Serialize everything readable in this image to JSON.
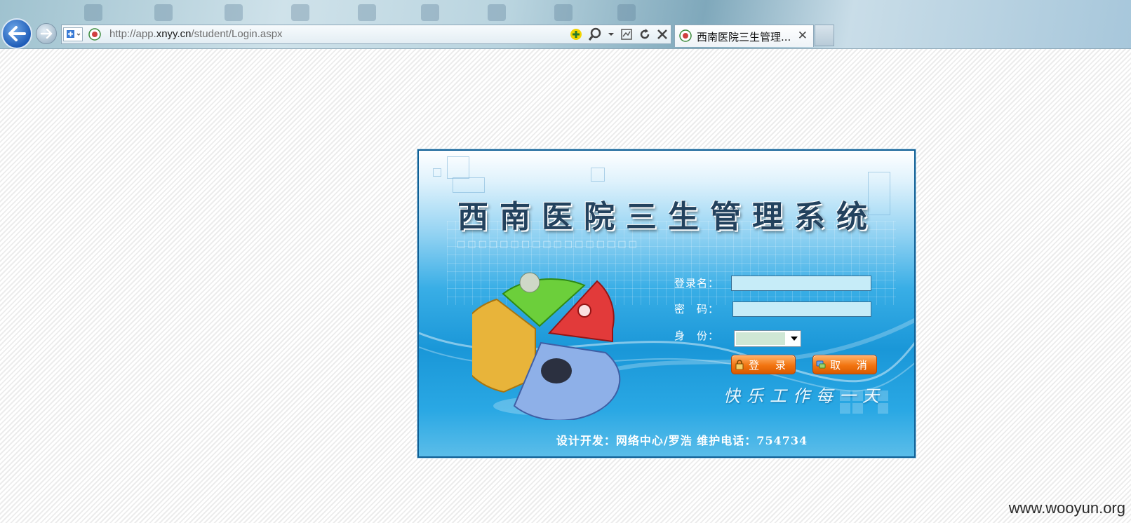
{
  "browser": {
    "url_prefix": "http://app.",
    "url_host": "xnyy.cn",
    "url_path": "/student/Login.aspx",
    "tab_title": "西南医院三生管理...",
    "tab_close": "✕",
    "icons": [
      "back-arrow-icon",
      "forward-arrow-icon",
      "compat-view-icon",
      "site-favicon",
      "add-on-icon",
      "search-icon",
      "dropdown-icon",
      "compat-icon",
      "refresh-icon",
      "stop-icon",
      "tab-close-icon"
    ]
  },
  "login": {
    "title": "西南医院三生管理系统",
    "faint_text": "□□□□□□□□□□□□□□□□□",
    "username_label": "登录名：",
    "username_value": "",
    "password_label": "密　码：",
    "password_value": "",
    "identity_label": "身　份：",
    "identity_value": "",
    "login_button": "登 录",
    "cancel_button": "取 消",
    "slogan": "快乐工作每一天",
    "footer": "设计开发：网络中心/罗浩 维护电话：754734"
  },
  "colors": {
    "panel_blue": "#1a97d8",
    "button_orange": "#f27410",
    "title_navy": "#23425e",
    "input_bg": "#c6ecf8"
  },
  "watermark": "www.wooyun.org"
}
